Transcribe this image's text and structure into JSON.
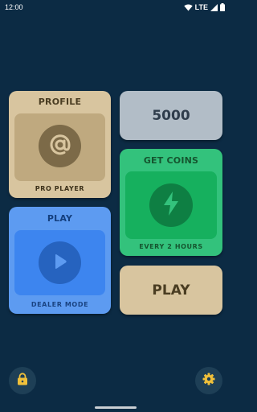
{
  "status_bar": {
    "time": "12:00",
    "network": "LTE",
    "icons": [
      "wifi-icon",
      "signal-icon",
      "battery-icon"
    ]
  },
  "profile_card": {
    "title": "PROFILE",
    "caption": "PRO PLAYER",
    "icon": "at-sign-icon",
    "color": "#d8c59f"
  },
  "coins": {
    "balance": "5000",
    "color": "#b2bdc7"
  },
  "get_coins_card": {
    "title": "GET COINS",
    "caption": "EVERY 2 HOURS",
    "icon": "lightning-bolt-icon",
    "color": "#33c27c"
  },
  "dealer_card": {
    "title": "PLAY",
    "caption": "DEALER MODE",
    "icon": "play-icon",
    "color": "#5d9bf1"
  },
  "play_button": {
    "label": "PLAY",
    "color": "#d8c59f"
  },
  "bottom_bar": {
    "left_icon": "lock-icon",
    "right_icon": "gear-icon"
  },
  "colors": {
    "background": "#0c2b44",
    "accent_gold": "#f0c03a"
  }
}
